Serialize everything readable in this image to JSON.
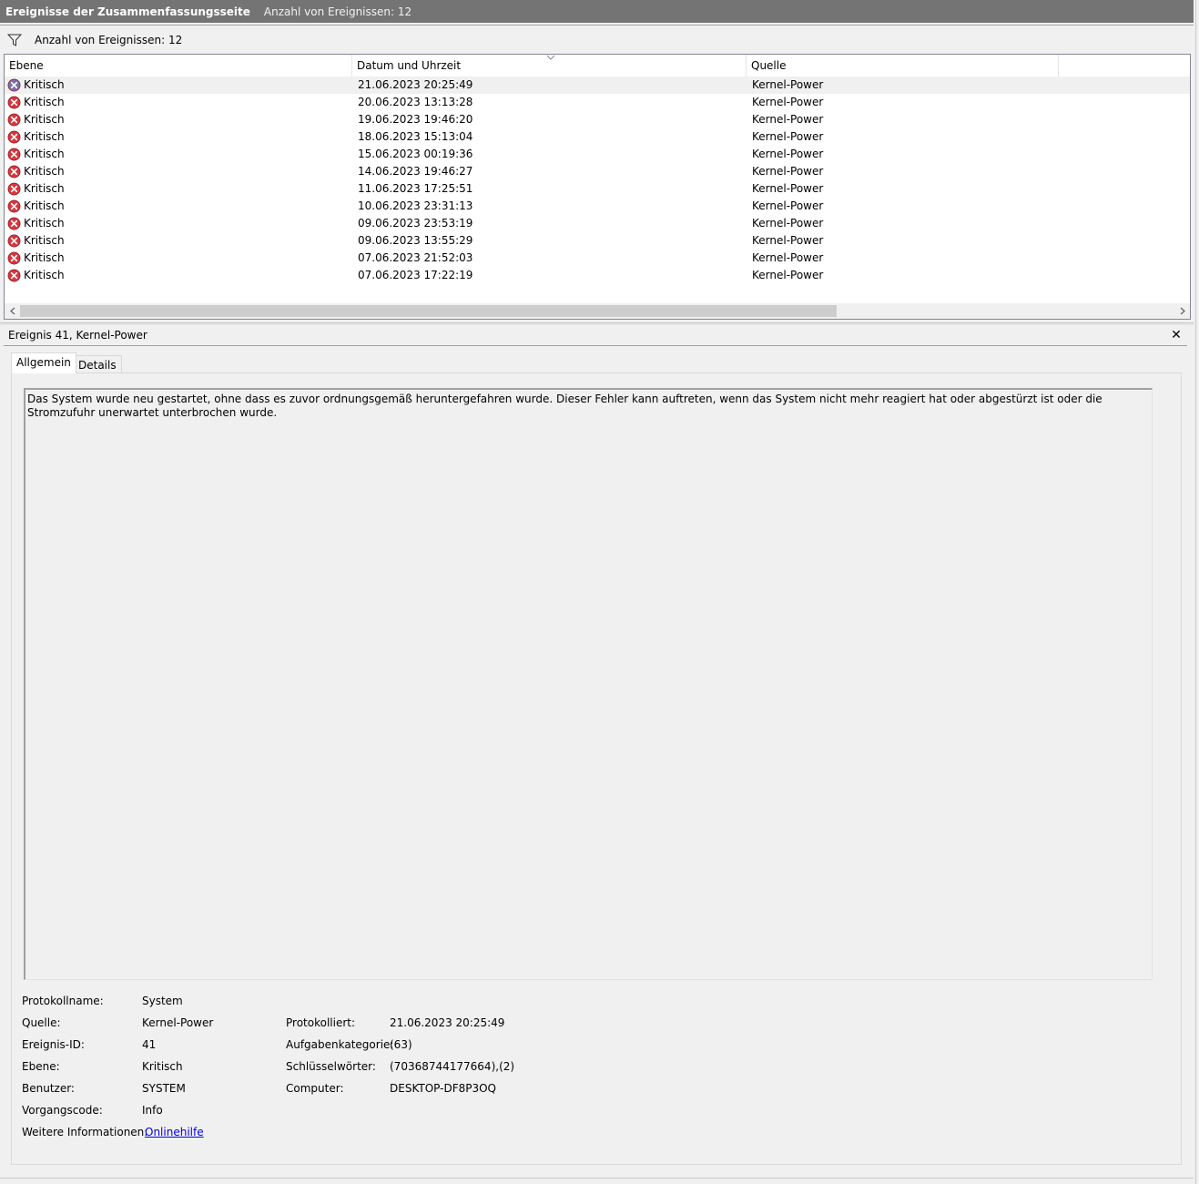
{
  "titlebar": {
    "title": "Ereignisse der Zusammenfassungsseite",
    "count_text": "Anzahl von Ereignissen: 12"
  },
  "filterbar": {
    "icon": "filter-icon",
    "text": "Anzahl von Ereignissen: 12"
  },
  "event_list": {
    "columns": [
      "Ebene",
      "Datum und Uhrzeit",
      "Quelle",
      ""
    ],
    "sorted_column": "Datum und Uhrzeit",
    "sort_direction": "descending",
    "rows": [
      {
        "level": "Kritisch",
        "datetime": "21.06.2023 20:25:49",
        "source": "Kernel-Power",
        "selected": true
      },
      {
        "level": "Kritisch",
        "datetime": "20.06.2023 13:13:28",
        "source": "Kernel-Power"
      },
      {
        "level": "Kritisch",
        "datetime": "19.06.2023 19:46:20",
        "source": "Kernel-Power"
      },
      {
        "level": "Kritisch",
        "datetime": "18.06.2023 15:13:04",
        "source": "Kernel-Power"
      },
      {
        "level": "Kritisch",
        "datetime": "15.06.2023 00:19:36",
        "source": "Kernel-Power"
      },
      {
        "level": "Kritisch",
        "datetime": "14.06.2023 19:46:27",
        "source": "Kernel-Power"
      },
      {
        "level": "Kritisch",
        "datetime": "11.06.2023 17:25:51",
        "source": "Kernel-Power"
      },
      {
        "level": "Kritisch",
        "datetime": "10.06.2023 23:31:13",
        "source": "Kernel-Power"
      },
      {
        "level": "Kritisch",
        "datetime": "09.06.2023 23:53:19",
        "source": "Kernel-Power"
      },
      {
        "level": "Kritisch",
        "datetime": "09.06.2023 13:55:29",
        "source": "Kernel-Power"
      },
      {
        "level": "Kritisch",
        "datetime": "07.06.2023 21:52:03",
        "source": "Kernel-Power"
      },
      {
        "level": "Kritisch",
        "datetime": "07.06.2023 17:22:19",
        "source": "Kernel-Power"
      }
    ],
    "level_icon": "critical-error-icon"
  },
  "detail": {
    "title": "Ereignis 41, Kernel-Power",
    "close_label": "✕",
    "tabs": [
      "Allgemein",
      "Details"
    ],
    "active_tab": "Allgemein",
    "description": "Das System wurde neu gestartet, ohne dass es zuvor ordnungsgemäß heruntergefahren wurde. Dieser Fehler kann auftreten, wenn das System nicht mehr reagiert hat oder abgestürzt ist oder die Stromzufuhr unerwartet unterbrochen wurde.",
    "properties": {
      "log_name_label": "Protokollname:",
      "log_name": "System",
      "source_label": "Quelle:",
      "source": "Kernel-Power",
      "logged_label": "Protokolliert:",
      "logged": "21.06.2023 20:25:49",
      "event_id_label": "Ereignis-ID:",
      "event_id": "41",
      "task_category_label": "Aufgabenkategorie:",
      "task_category": "(63)",
      "level_label": "Ebene:",
      "level": "Kritisch",
      "keywords_label": "Schlüsselwörter:",
      "keywords": "(70368744177664),(2)",
      "user_label": "Benutzer:",
      "user": "SYSTEM",
      "computer_label": "Computer:",
      "computer": "DESKTOP-DF8P3OQ",
      "opcode_label": "Vorgangscode:",
      "opcode": "Info",
      "more_info_label": "Weitere Informationen:",
      "more_info_link": "Onlinehilfe"
    }
  },
  "colors": {
    "titlebar_bg": "#747474",
    "critical_red": "#d9363e",
    "link_blue": "#0000ee"
  }
}
